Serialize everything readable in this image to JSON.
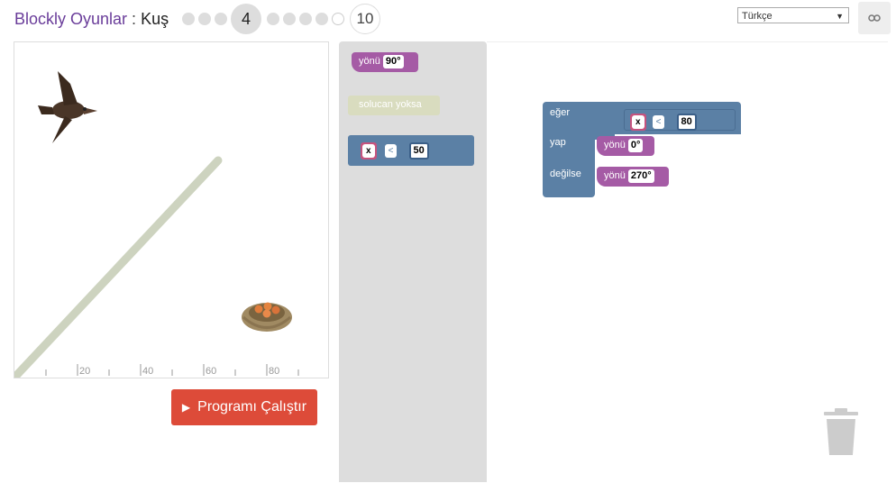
{
  "header": {
    "app_name": "Blockly Oyunlar",
    "separator": " : ",
    "game_name": "Kuş",
    "current_level": "4",
    "max_level": "10",
    "language": "Türkçe"
  },
  "visualization": {
    "ticks": [
      "20",
      "40",
      "60",
      "80"
    ]
  },
  "run_button": {
    "label": "Programı Çalıştır"
  },
  "toolbox": {
    "heading_block": {
      "label": "yönü",
      "value": "90°"
    },
    "no_worm_block": {
      "label": "solucan yoksa"
    },
    "compare_block": {
      "var": "x",
      "op": "<",
      "value": "50"
    }
  },
  "workspace": {
    "if_label": "eğer",
    "do_label": "yap",
    "else_label": "değilse",
    "condition": {
      "var": "x",
      "op": "<",
      "value": "80"
    },
    "do_block": {
      "label": "yönü",
      "value": "0°"
    },
    "else_block": {
      "label": "yönü",
      "value": "270°"
    }
  }
}
